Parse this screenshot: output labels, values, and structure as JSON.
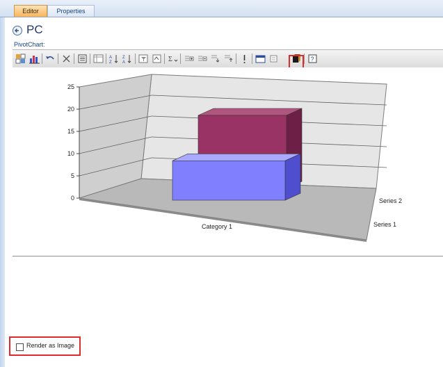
{
  "tabs": [
    {
      "label": "Editor",
      "active": true
    },
    {
      "label": "Properties",
      "active": false
    }
  ],
  "page": {
    "title": "PC",
    "back_icon": "back-arrow-icon"
  },
  "pivot": {
    "label": "PivotChart:"
  },
  "toolbar": {
    "icons": [
      "field-list-icon",
      "chart-type-icon",
      "undo-icon",
      "delete-icon",
      "commands-options-icon",
      "drop-zones-icon",
      "sort-ascending-icon",
      "sort-descending-icon",
      "filter-icon",
      "show-top-icon",
      "autocalc-icon",
      "expand-icon",
      "collapse-icon",
      "drill-icon",
      "drill-out-icon",
      "info-icon",
      "export-icon",
      "legend-icon",
      "view-3d-icon",
      "help-icon"
    ],
    "highlighted_icon": "view-3d-icon",
    "highlight_color": "#e02b2b"
  },
  "chart_data": {
    "type": "bar",
    "categories": [
      "Category 1"
    ],
    "series": [
      {
        "name": "Series 1",
        "values": [
          9
        ],
        "color": "#8080ff"
      },
      {
        "name": "Series 2",
        "values": [
          21
        ],
        "color": "#993366"
      }
    ],
    "ylim": [
      0,
      25
    ],
    "yticks": [
      "0",
      "5",
      "10",
      "15",
      "20",
      "25"
    ],
    "grid": true,
    "legend": "none",
    "three_d": true
  },
  "render_option": {
    "label": "Render as Image",
    "checked": false
  }
}
